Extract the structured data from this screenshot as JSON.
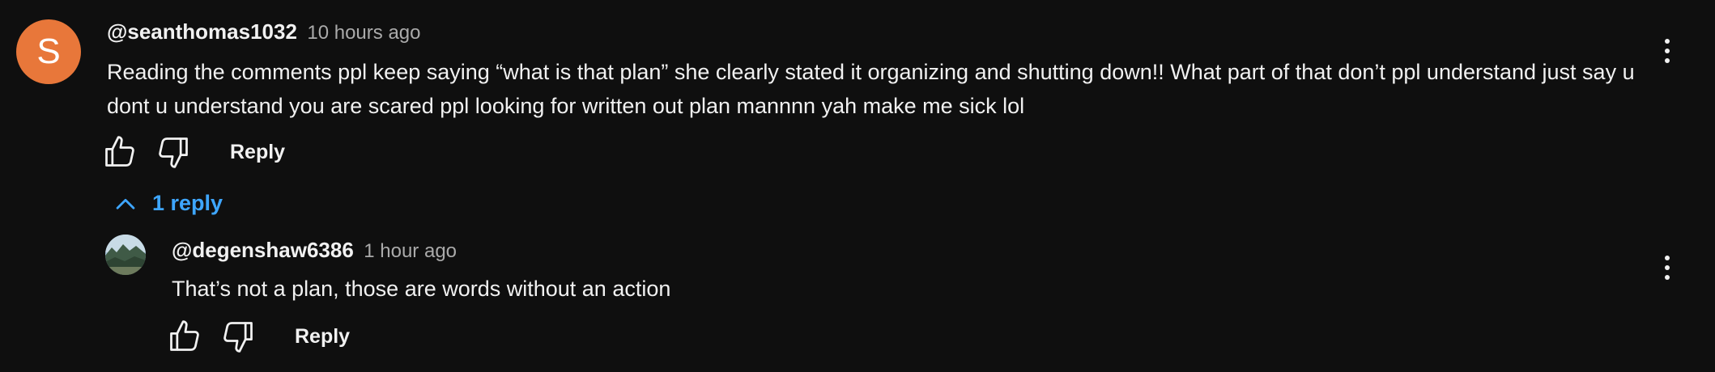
{
  "comment": {
    "avatar_letter": "S",
    "avatar_color": "#e8773a",
    "author": "@seanthomas1032",
    "time": "10 hours ago",
    "text": "Reading the comments ppl keep saying “what is that plan” she clearly stated it organizing and shutting down!! What part of that don’t ppl understand just say u dont u understand you are scared ppl looking for written out plan mannnn yah make me sick lol",
    "reply_label": "Reply",
    "like_icon": "thumbs-up-icon",
    "dislike_icon": "thumbs-down-icon",
    "menu_icon": "more-vert-icon"
  },
  "replies_toggle": {
    "label": "1 reply",
    "icon": "chevron-up-icon",
    "color": "#3ea6ff"
  },
  "reply": {
    "author": "@degenshaw6386",
    "time": "1 hour ago",
    "text": "That’s not a plan, those are words without an action",
    "reply_label": "Reply",
    "like_icon": "thumbs-up-icon",
    "dislike_icon": "thumbs-down-icon",
    "menu_icon": "more-vert-icon"
  }
}
